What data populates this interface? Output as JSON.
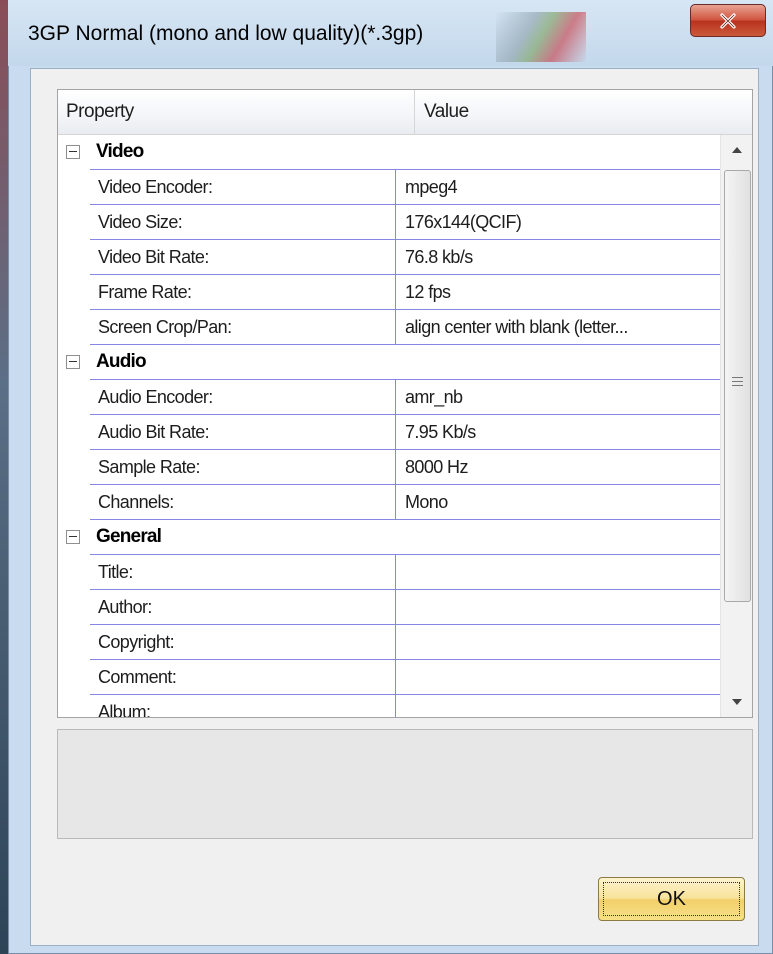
{
  "window": {
    "title": "3GP Normal (mono and low quality)(*.3gp)"
  },
  "grid": {
    "header": {
      "property": "Property",
      "value": "Value"
    },
    "sections": [
      {
        "name": "Video",
        "rows": [
          {
            "label": "Video Encoder:",
            "value": "mpeg4"
          },
          {
            "label": "Video Size:",
            "value": "176x144(QCIF)"
          },
          {
            "label": "Video Bit Rate:",
            "value": "76.8 kb/s"
          },
          {
            "label": "Frame Rate:",
            "value": "12 fps"
          },
          {
            "label": "Screen Crop/Pan:",
            "value": "align center with blank (letter..."
          }
        ]
      },
      {
        "name": "Audio",
        "rows": [
          {
            "label": "Audio Encoder:",
            "value": "amr_nb"
          },
          {
            "label": "Audio Bit Rate:",
            "value": "7.95 Kb/s"
          },
          {
            "label": "Sample Rate:",
            "value": "8000 Hz"
          },
          {
            "label": "Channels:",
            "value": "Mono"
          }
        ]
      },
      {
        "name": "General",
        "rows": [
          {
            "label": "Title:",
            "value": ""
          },
          {
            "label": "Author:",
            "value": ""
          },
          {
            "label": "Copyright:",
            "value": ""
          },
          {
            "label": "Comment:",
            "value": ""
          },
          {
            "label": "Album:",
            "value": ""
          }
        ]
      }
    ],
    "scroll": {
      "position": 0.0
    }
  },
  "buttons": {
    "ok": "OK"
  },
  "icons": {
    "close": "close-icon",
    "collapse": "minus-square-icon",
    "scroll_up": "arrow-up-icon",
    "scroll_down": "arrow-down-icon",
    "grip": "grip-icon"
  }
}
